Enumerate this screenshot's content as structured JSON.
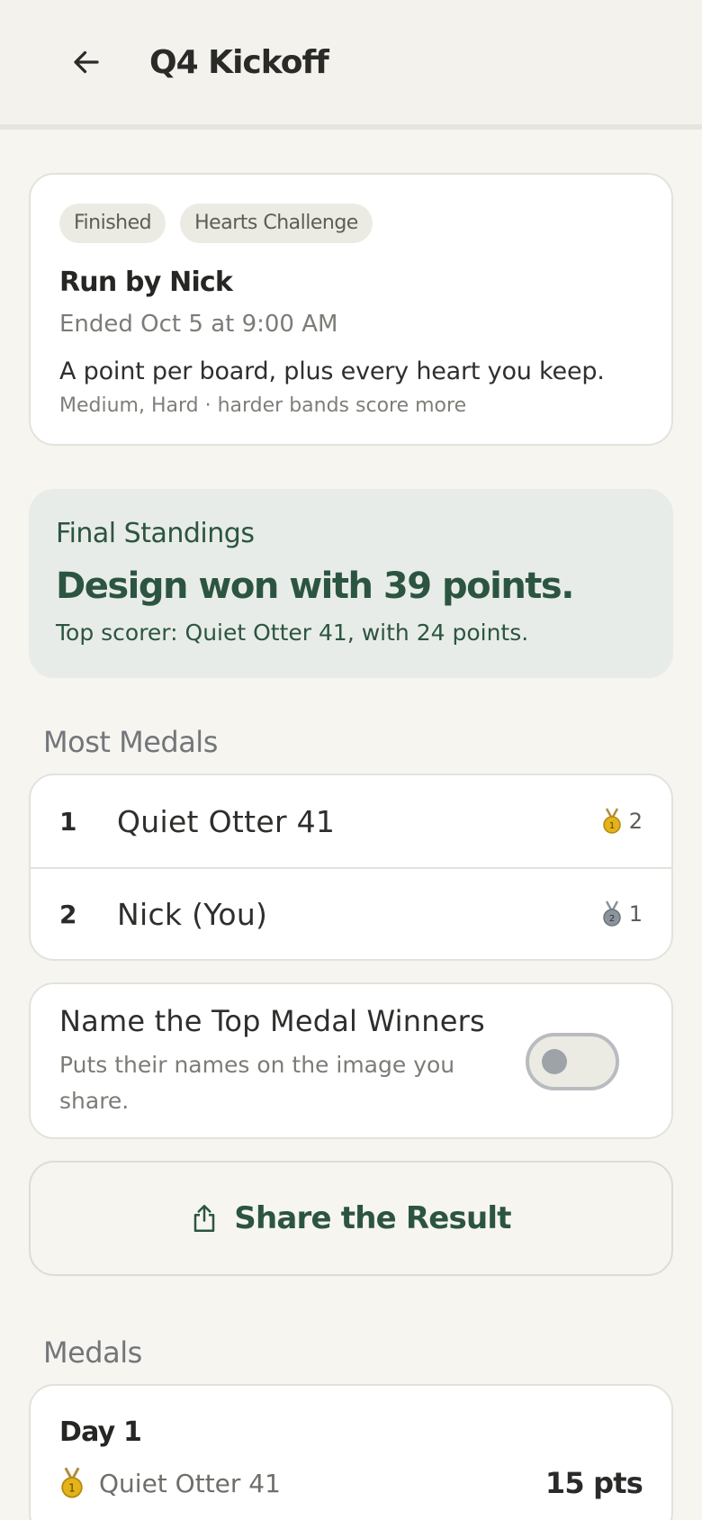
{
  "header": {
    "title": "Q4 Kickoff",
    "back_icon": "arrow-left-icon"
  },
  "info": {
    "chips": [
      "Finished",
      "Hearts Challenge"
    ],
    "run_by": "Run by Nick",
    "ended": "Ended Oct 5 at 9:00 AM",
    "rule": "A point per board, plus every heart you keep.",
    "bands": "Medium, Hard · harder bands score more"
  },
  "standings": {
    "label": "Final Standings",
    "headline": "Design won with 39 points.",
    "sub": "Top scorer: Quiet Otter 41, with 24 points."
  },
  "most_medals": {
    "title": "Most Medals",
    "rows": [
      {
        "rank": "1",
        "name": "Quiet Otter 41",
        "medal": "gold-medal-icon",
        "medal_num": "1",
        "count": "2"
      },
      {
        "rank": "2",
        "name": "Nick (You)",
        "medal": "silver-medal-icon",
        "medal_num": "2",
        "count": "1"
      }
    ]
  },
  "toggle": {
    "title": "Name the Top Medal Winners",
    "desc": "Puts their names on the image you share.",
    "on": false
  },
  "share": {
    "label": "Share the Result",
    "icon": "share-icon"
  },
  "medals": {
    "title": "Medals",
    "days": [
      {
        "title": "Day 1",
        "rows": [
          {
            "medal_num": "1",
            "name": "Quiet Otter 41",
            "pts": "15 pts"
          }
        ]
      }
    ]
  },
  "colors": {
    "accent": "#2c5541",
    "background": "#f6f5f0",
    "gold": "#e3b319",
    "silver": "#8b949c"
  }
}
